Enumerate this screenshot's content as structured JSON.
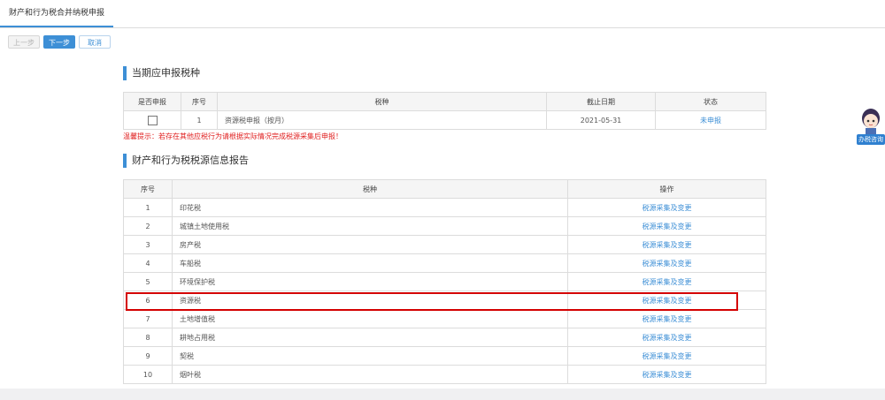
{
  "tab": {
    "title": "财产和行为税合并纳税申报"
  },
  "toolbar": {
    "prev": "上一步",
    "next": "下一步",
    "cancel": "取消"
  },
  "section1": {
    "title": "当期应申报税种",
    "headers": [
      "是否申报",
      "序号",
      "税种",
      "截止日期",
      "状态"
    ],
    "row": {
      "index": "1",
      "tax": "资源税申报（按月）",
      "deadline": "2021-05-31",
      "status": "未申报"
    }
  },
  "warning": "温馨提示：若存在其他应税行为请根据实际情况完成税源采集后申报！",
  "section2": {
    "title": "财产和行为税税源信息报告",
    "headers": [
      "序号",
      "税种",
      "操作"
    ],
    "action": "税源采集及变更",
    "rows": [
      {
        "index": "1",
        "tax": "印花税"
      },
      {
        "index": "2",
        "tax": "城镇土地使用税"
      },
      {
        "index": "3",
        "tax": "房产税"
      },
      {
        "index": "4",
        "tax": "车船税"
      },
      {
        "index": "5",
        "tax": "环境保护税"
      },
      {
        "index": "6",
        "tax": "资源税"
      },
      {
        "index": "7",
        "tax": "土地增值税"
      },
      {
        "index": "8",
        "tax": "耕地占用税"
      },
      {
        "index": "9",
        "tax": "契税"
      },
      {
        "index": "10",
        "tax": "烟叶税"
      }
    ]
  },
  "assistant": {
    "label": "办税咨询"
  },
  "colors": {
    "accent": "#3d8fd6",
    "warning": "#e02020",
    "highlight": "#d40000"
  }
}
